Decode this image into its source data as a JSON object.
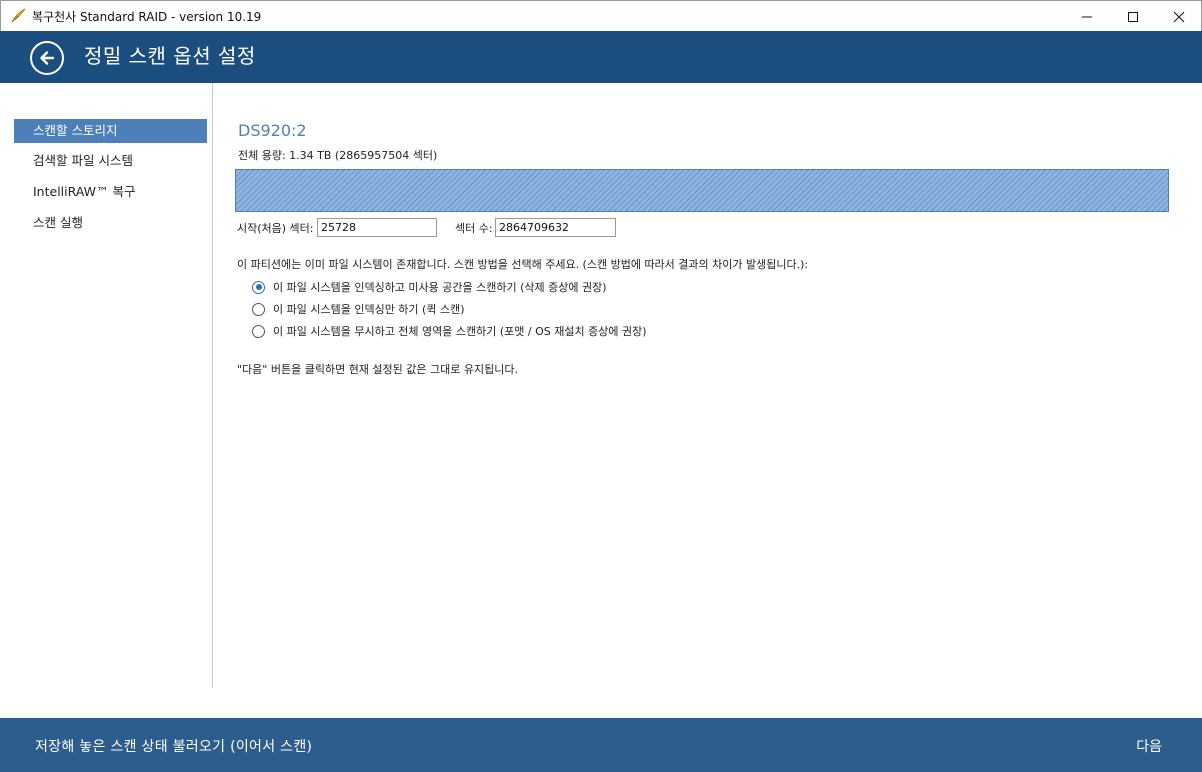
{
  "window": {
    "title": "복구천사 Standard RAID - version 10.19",
    "icon": "app-feather-icon",
    "controls": [
      "minimize-icon",
      "maximize-icon",
      "close-icon"
    ]
  },
  "header": {
    "back_icon": "arrow-left-icon",
    "title": "정밀 스캔 옵션 설정"
  },
  "sidebar": {
    "items": [
      {
        "label": "스캔할 스토리지",
        "active": true
      },
      {
        "label": "검색할 파일 시스템",
        "active": false
      },
      {
        "label": "IntelliRAW™ 복구",
        "active": false
      },
      {
        "label": "스캔 실행",
        "active": false
      }
    ]
  },
  "main": {
    "drive_name": "DS920:2",
    "capacity": "전체 용량: 1.34 TB (2865957504 섹터)",
    "start_sector": {
      "label": "시작(처음) 섹터:",
      "value": "25728"
    },
    "sector_count": {
      "label": "섹터 수:",
      "value": "2864709632"
    },
    "info": "이 파티션에는 이미 파일 시스템이 존재합니다. 스캔 방법을 선택해 주세요. (스캔 방법에 따라서 결과의 차이가 발생됩니다.):",
    "options": [
      {
        "label": "이 파일 시스템을 인덱싱하고 미사용 공간을 스캔하기 (삭제 증상에 권장)",
        "checked": true
      },
      {
        "label": "이 파일 시스템을 인덱싱만 하기 (퀵 스캔)",
        "checked": false
      },
      {
        "label": "이 파일 시스템을 무시하고 전체 영역을 스캔하기 (포맷 / OS 재설치 증상에 권장)",
        "checked": false
      }
    ],
    "hint": "\"다음\" 버튼을 클릭하면 현재 설정된 값은 그대로 유지됩니다."
  },
  "footer": {
    "load_state": "저장해 놓은 스캔 상태 불러오기 (이어서 스캔)",
    "next": "다음"
  },
  "colors": {
    "header_bg": "#1b4e7f",
    "footer_bg": "#2c5d8d",
    "accent": "#4d7fb8",
    "bar_fill": "#8fb4e0"
  }
}
